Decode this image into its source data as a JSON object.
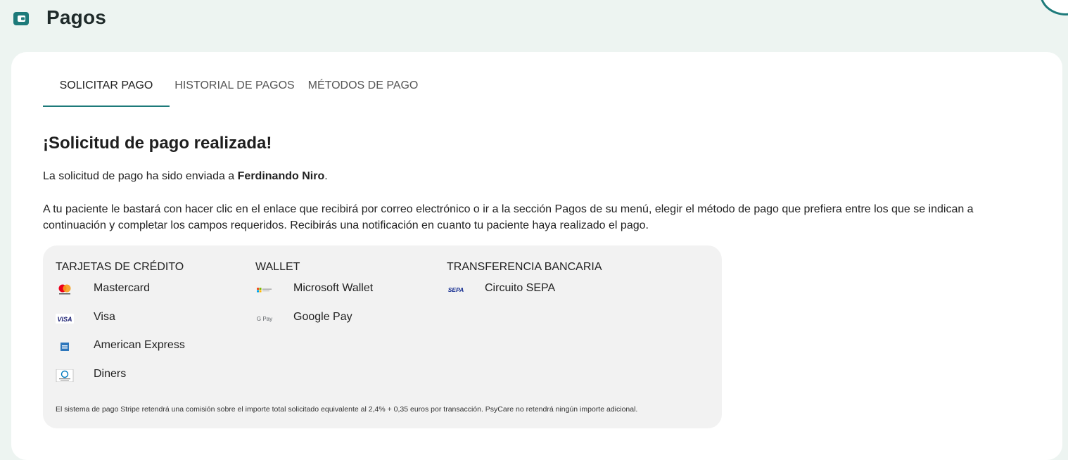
{
  "header": {
    "title": "Pagos",
    "icon": "wallet-icon",
    "accent_color": "#1d7a7a"
  },
  "tabs": [
    {
      "label": "SOLICITAR PAGO",
      "active": true
    },
    {
      "label": "HISTORIAL DE PAGOS",
      "active": false
    },
    {
      "label": "MÉTODOS DE PAGO",
      "active": false
    }
  ],
  "main": {
    "heading": "¡Solicitud de pago realizada!",
    "sent_prefix": "La solicitud de pago ha sido enviada a ",
    "recipient": "Ferdinando Niro",
    "sent_suffix": ".",
    "instructions": "A tu paciente le bastará con hacer clic en el enlace que recibirá por correo electrónico o ir a la sección Pagos de su menú, elegir el método de pago que prefiera entre los que se indican a continuación y completar los campos requeridos. Recibirás una notificación en cuanto tu paciente haya realizado el pago."
  },
  "methods": {
    "credit_cards": {
      "title": "TARJETAS DE CRÉDITO",
      "items": [
        {
          "label": "Mastercard",
          "icon": "mastercard-icon"
        },
        {
          "label": "Visa",
          "icon": "visa-icon"
        },
        {
          "label": "American Express",
          "icon": "amex-icon"
        },
        {
          "label": "Diners",
          "icon": "diners-icon"
        }
      ]
    },
    "wallet": {
      "title": "WALLET",
      "items": [
        {
          "label": "Microsoft Wallet",
          "icon": "microsoft-wallet-icon"
        },
        {
          "label": "Google Pay",
          "icon": "google-pay-icon"
        }
      ]
    },
    "bank_transfer": {
      "title": "TRANSFERENCIA BANCARIA",
      "items": [
        {
          "label": "Circuito SEPA",
          "icon": "sepa-icon"
        }
      ]
    },
    "fee_note": "El sistema de pago Stripe retendrá una comisión sobre el importe total solicitado equivalente al 2,4% + 0,35 euros por transacción. PsyCare no retendrá ningún importe adicional."
  }
}
